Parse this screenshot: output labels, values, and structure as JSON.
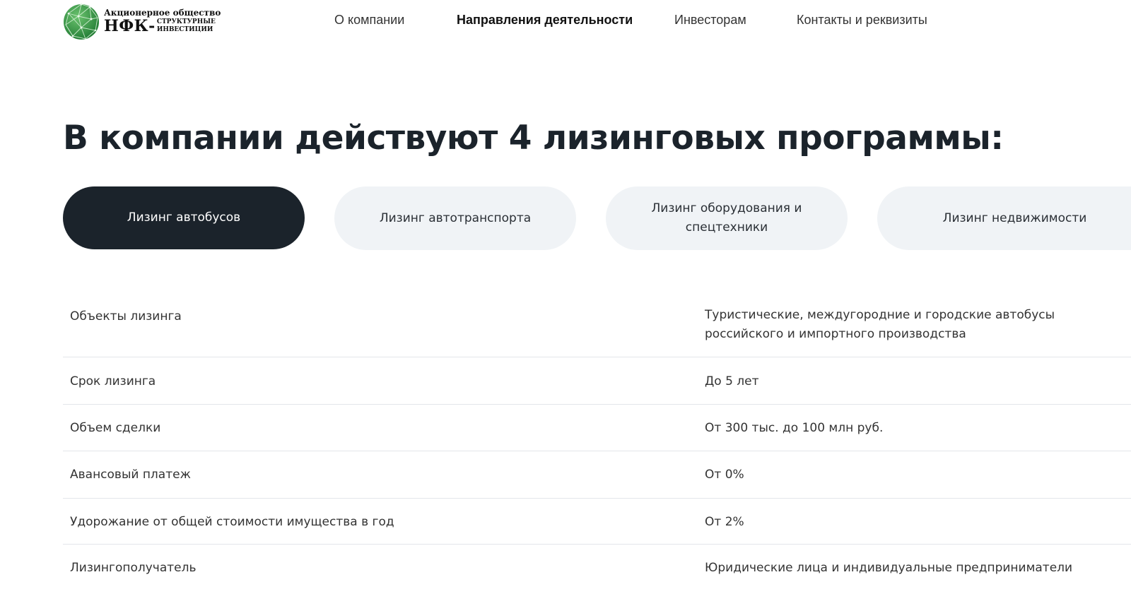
{
  "header": {
    "logo": {
      "top": "Акционерное общество",
      "abbr": "НФК-",
      "sub_1": "СТРУКТУРНЫЕ",
      "sub_2": "ИНВЕСТИЦИИ",
      "icon": "globe-network-logo-icon"
    },
    "nav": [
      {
        "label": "О компании",
        "active": false
      },
      {
        "label": "Направления деятельности",
        "active": true
      },
      {
        "label": "Инвесторам",
        "active": false
      },
      {
        "label": "Контакты и реквизиты",
        "active": false
      }
    ]
  },
  "main": {
    "title": "В компании действуют 4 лизинговых программы:",
    "tabs": [
      {
        "label": "Лизинг автобусов",
        "active": true
      },
      {
        "label": "Лизинг автотранспорта",
        "active": false
      },
      {
        "label": "Лизинг оборудования и спецтехники",
        "active": false
      },
      {
        "label": "Лизинг недвижимости",
        "active": false
      }
    ],
    "table": [
      {
        "label": "Объекты лизинга",
        "value": "Туристические, междугородние и городские автобусы российского и импортного производства"
      },
      {
        "label": "Срок лизинга",
        "value": "До 5 лет"
      },
      {
        "label": "Объем сделки",
        "value": "От 300 тыс. до 100 млн руб."
      },
      {
        "label": "Авансовый платеж",
        "value": "От 0%"
      },
      {
        "label": "Удорожание от общей стоимости имущества в год",
        "value": "От 2%"
      },
      {
        "label": "Лизингополучатель",
        "value": "Юридические лица и индивидуальные предприниматели"
      }
    ]
  },
  "colors": {
    "logo_green": "#2e8b3e",
    "active_tab_bg": "#1b232b",
    "tab_bg": "#f0f3f6",
    "divider": "#e3e6ea"
  }
}
